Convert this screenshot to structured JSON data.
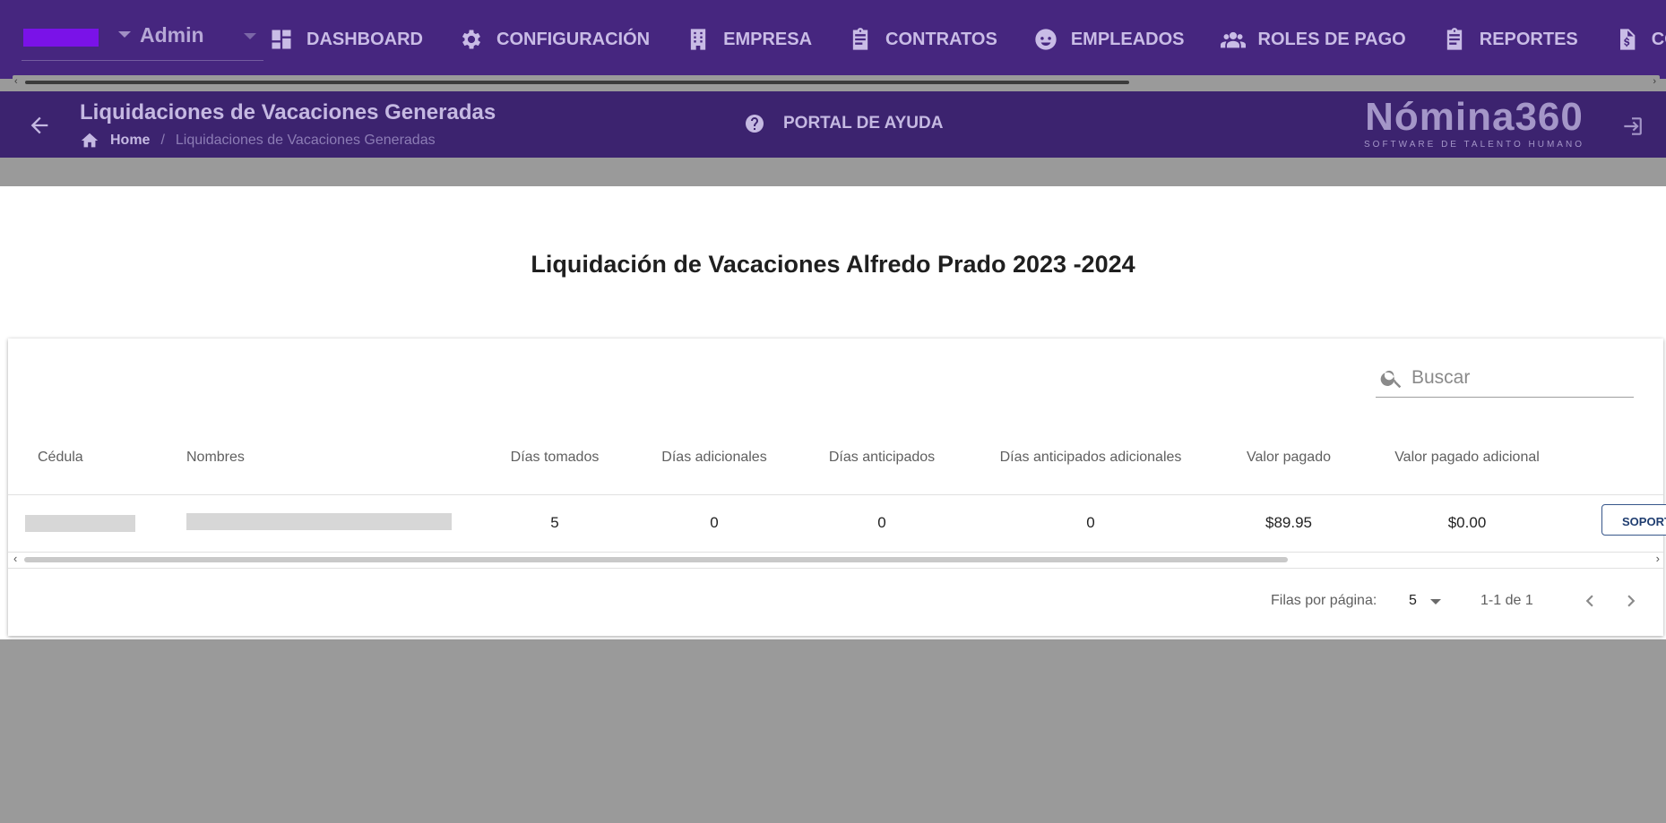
{
  "nav": {
    "role_label": "Admin",
    "items": [
      {
        "label": "DASHBOARD",
        "icon": "dashboard-icon"
      },
      {
        "label": "CONFIGURACIÓN",
        "icon": "gear-icon"
      },
      {
        "label": "EMPRESA",
        "icon": "building-icon"
      },
      {
        "label": "CONTRATOS",
        "icon": "clipboard-icon"
      },
      {
        "label": "EMPLEADOS",
        "icon": "face-icon"
      },
      {
        "label": "ROLES DE PAGO",
        "icon": "people-icon"
      },
      {
        "label": "REPORTES",
        "icon": "report-icon"
      },
      {
        "label": "COSTOS",
        "icon": "invoice-icon"
      }
    ]
  },
  "header": {
    "title": "Liquidaciones de Vacaciones Generadas",
    "breadcrumb": {
      "home": "Home",
      "separator": "/",
      "current": "Liquidaciones de Vacaciones Generadas"
    },
    "help_label": "PORTAL DE AYUDA",
    "brand": {
      "name": "Nómina360",
      "tagline": "SOFTWARE DE TALENTO HUMANO"
    }
  },
  "report": {
    "title": "Liquidación de Vacaciones Alfredo Prado 2023 -2024"
  },
  "table": {
    "search_placeholder": "Buscar",
    "columns": [
      "Cédula",
      "Nombres",
      "Días tomados",
      "Días adicionales",
      "Días anticipados",
      "Días anticipados adicionales",
      "Valor pagado",
      "Valor pagado adicional"
    ],
    "rows": [
      {
        "cedula": "",
        "nombres": "",
        "dias_tomados": "5",
        "dias_adicionales": "0",
        "dias_anticipados": "0",
        "dias_anticipados_adicionales": "0",
        "valor_pagado": "$89.95",
        "valor_pagado_adicional": "$0.00",
        "action_label": "SOPORTE"
      }
    ],
    "footer": {
      "rows_per_page_label": "Filas por página:",
      "rows_per_page_value": "5",
      "range": "1-1 de 1"
    }
  },
  "colors": {
    "nav_bg": "#46267f",
    "subheader_bg": "#3c236f",
    "overlay_gray": "#9a9a9a",
    "accent_swatch": "#7a12e8",
    "action_border": "#37568a"
  }
}
